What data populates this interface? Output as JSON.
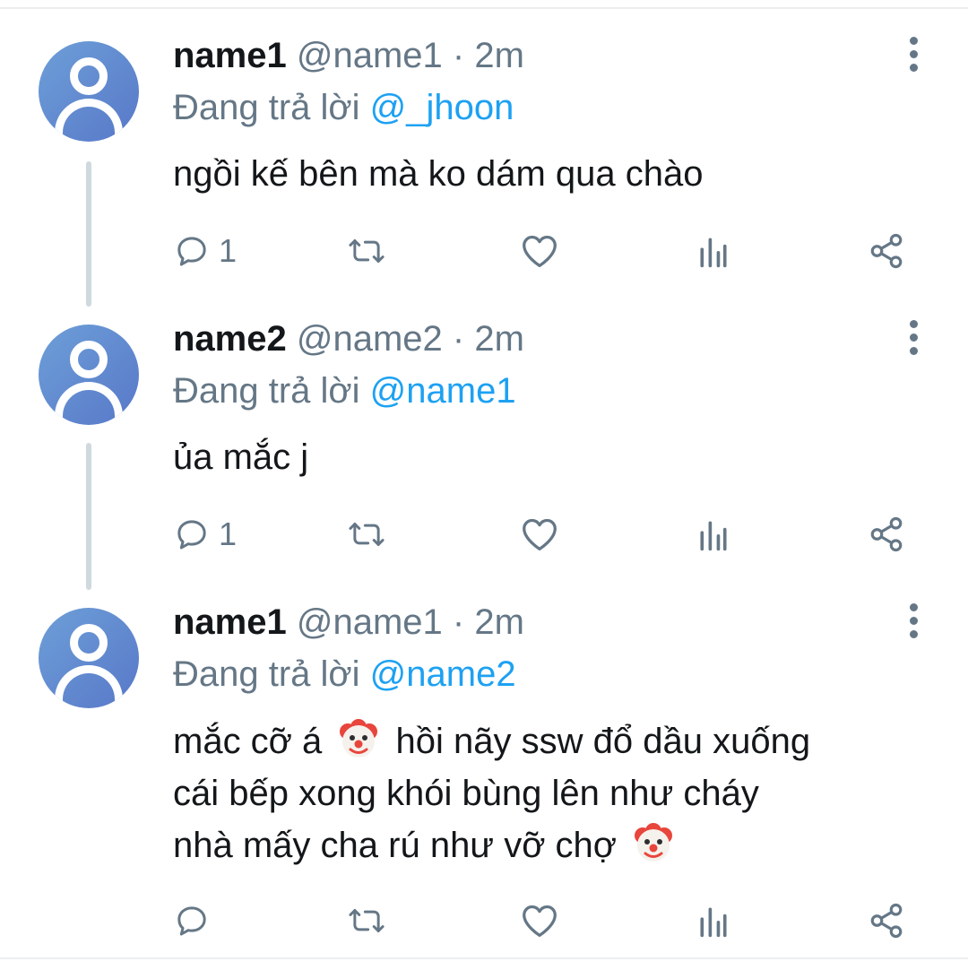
{
  "tweets": [
    {
      "name": "name1",
      "handle": "@name1",
      "separator": "·",
      "time": "2m",
      "reply_prefix": "Đang trả lời",
      "reply_to": "@_jhoon",
      "text_lines": [
        "ngồi kế bên mà ko dám qua chào"
      ],
      "reply_count": "1"
    },
    {
      "name": "name2",
      "handle": "@name2",
      "separator": "·",
      "time": "2m",
      "reply_prefix": "Đang trả lời",
      "reply_to": "@name1",
      "text_lines": [
        "ủa mắc j"
      ],
      "reply_count": "1"
    },
    {
      "name": "name1",
      "handle": "@name1",
      "separator": "·",
      "time": "2m",
      "reply_prefix": "Đang trả lời",
      "reply_to": "@name2",
      "text_parts": {
        "line1_a": "mắc cỡ á",
        "line1_b": "hồi nãy ssw đổ dầu xuống",
        "line2": "cái bếp xong khói bùng lên như cháy",
        "line3": "nhà mấy cha rú như vỡ chợ"
      },
      "emoji": "clown-face-emoji",
      "reply_count": ""
    }
  ],
  "icons": {
    "reply": "reply-icon",
    "retweet": "retweet-icon",
    "like": "heart-icon",
    "analytics": "analytics-icon",
    "share": "share-icon",
    "more": "more-vertical-icon"
  },
  "colors": {
    "text": "#14171a",
    "secondary": "#657786",
    "link": "#1da1f2",
    "avatar": "#5f85cf",
    "thread_line": "#cfd9de"
  }
}
